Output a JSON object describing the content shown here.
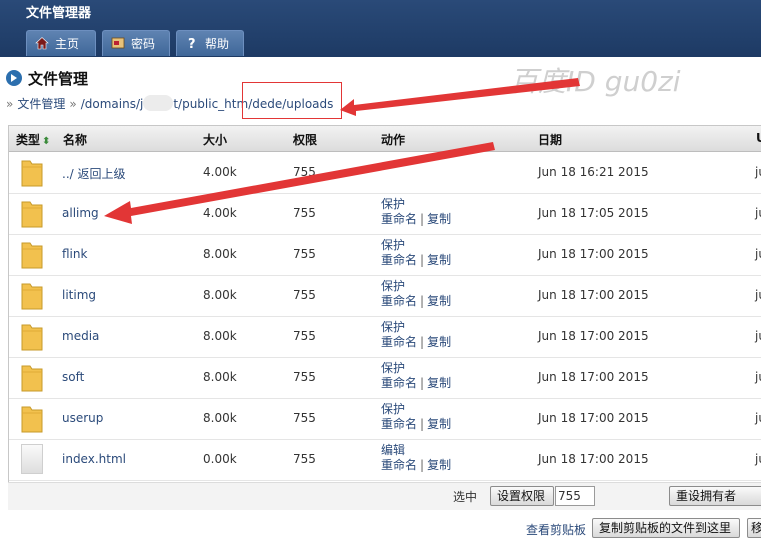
{
  "app": {
    "title": "文件管理器"
  },
  "tabs": [
    {
      "label": "主页",
      "icon": "home-icon"
    },
    {
      "label": "密码",
      "icon": "key-icon"
    },
    {
      "label": "帮助",
      "icon": "help-icon"
    }
  ],
  "section": {
    "title": "文件管理"
  },
  "breadcrumb": {
    "root": "文件管理",
    "path_a": "/domains/j",
    "path_b": "t/public_htm",
    "path_c": "/dede/uploads"
  },
  "watermark": "百度ID gu0zi",
  "table": {
    "headers": {
      "type": "类型",
      "name": "名称",
      "size": "大小",
      "perm": "权限",
      "action": "动作",
      "date": "日期",
      "user": "U"
    },
    "rows": [
      {
        "kind": "folder",
        "name": "../ 返回上级",
        "size": "4.00k",
        "perm": "755",
        "act1": "",
        "act2": "",
        "act3": "",
        "date": "Jun 18 16:21 2015",
        "user": "ju"
      },
      {
        "kind": "folder",
        "name": "allimg",
        "size": "4.00k",
        "perm": "755",
        "act1": "保护",
        "act2": "重命名",
        "act3": "复制",
        "date": "Jun 18 17:05 2015",
        "user": "ju"
      },
      {
        "kind": "folder",
        "name": "flink",
        "size": "8.00k",
        "perm": "755",
        "act1": "保护",
        "act2": "重命名",
        "act3": "复制",
        "date": "Jun 18 17:00 2015",
        "user": "ju"
      },
      {
        "kind": "folder",
        "name": "litimg",
        "size": "8.00k",
        "perm": "755",
        "act1": "保护",
        "act2": "重命名",
        "act3": "复制",
        "date": "Jun 18 17:00 2015",
        "user": "ju"
      },
      {
        "kind": "folder",
        "name": "media",
        "size": "8.00k",
        "perm": "755",
        "act1": "保护",
        "act2": "重命名",
        "act3": "复制",
        "date": "Jun 18 17:00 2015",
        "user": "ju"
      },
      {
        "kind": "folder",
        "name": "soft",
        "size": "8.00k",
        "perm": "755",
        "act1": "保护",
        "act2": "重命名",
        "act3": "复制",
        "date": "Jun 18 17:00 2015",
        "user": "ju"
      },
      {
        "kind": "folder",
        "name": "userup",
        "size": "8.00k",
        "perm": "755",
        "act1": "保护",
        "act2": "重命名",
        "act3": "复制",
        "date": "Jun 18 17:00 2015",
        "user": "ju"
      },
      {
        "kind": "file",
        "name": "index.html",
        "size": "0.00k",
        "perm": "755",
        "act1": "编辑",
        "act2": "重命名",
        "act3": "复制",
        "date": "Jun 18 17:00 2015",
        "user": "ju"
      }
    ]
  },
  "toolbar": {
    "selected_label": "选中",
    "set_perm_button": "设置权限",
    "perm_value": "755",
    "owner_button": "重设拥有者",
    "view_clipboard": "查看剪贴板",
    "copy_here_button": "复制剪贴板的文件到这里",
    "move_button": "移"
  },
  "colors": {
    "header": "#1d3a64",
    "link": "#2b4a7a",
    "annotation": "#e23636",
    "folder": "#f2c14e"
  }
}
